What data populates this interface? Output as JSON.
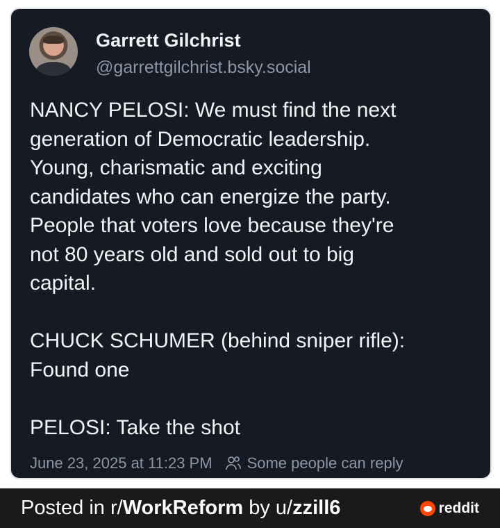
{
  "post": {
    "author_name": "Garrett Gilchrist",
    "author_handle": "@garrettgilchrist.bsky.social",
    "body": "NANCY PELOSI: We must find the next\ngeneration of Democratic leadership.\nYoung, charismatic and exciting\ncandidates who can energize the party.\nPeople that voters love because they're\nnot 80 years old and sold out to big\ncapital.\n\nCHUCK SCHUMER (behind sniper rifle):\nFound one\n\nPELOSI: Take the shot",
    "timestamp": "June 23, 2025 at 11:23 PM",
    "reply_setting": "Some people can reply",
    "reply_icon": "people-icon"
  },
  "footer": {
    "posted_in_prefix": "Posted in r/",
    "subreddit": "WorkReform",
    "by_prefix": " by u/",
    "username": "zzill6",
    "brand": "reddit",
    "brand_color": "#ff4500"
  },
  "colors": {
    "card_bg": "#151a23",
    "text_primary": "#f3f5f8",
    "text_secondary": "#8c96a6",
    "footer_bg": "#1a1a1b"
  }
}
